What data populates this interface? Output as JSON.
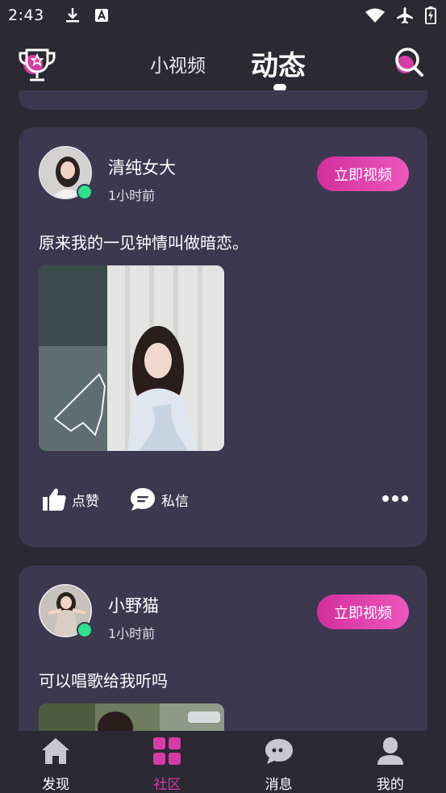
{
  "status_bar": {
    "time": "2:43"
  },
  "top_nav": {
    "tab_video": "小视频",
    "tab_feed": "动态"
  },
  "posts": [
    {
      "username": "清纯女大",
      "time": "1小时前",
      "text": "原来我的一见钟情叫做暗恋。",
      "video_btn": "立即视频",
      "like_label": "点赞",
      "msg_label": "私信"
    },
    {
      "username": "小野猫",
      "time": "1小时前",
      "text": "可以唱歌给我听吗",
      "video_btn": "立即视频"
    }
  ],
  "bottom_nav": [
    {
      "label": "发现",
      "active": false
    },
    {
      "label": "社区",
      "active": true
    },
    {
      "label": "消息",
      "active": false
    },
    {
      "label": "我的",
      "active": false
    }
  ],
  "colors": {
    "accent": "#d63ca6",
    "card": "#3b3850",
    "bg": "#2b2933",
    "online": "#2fe08f"
  },
  "icons": [
    "download-icon",
    "keyboard-a-icon",
    "wifi-icon",
    "airplane-icon",
    "battery-icon",
    "trophy-icon",
    "search-icon",
    "thumbs-up-icon",
    "chat-bubble-icon",
    "more-dots-icon",
    "home-icon",
    "grid-icon",
    "message-icon",
    "user-icon"
  ]
}
